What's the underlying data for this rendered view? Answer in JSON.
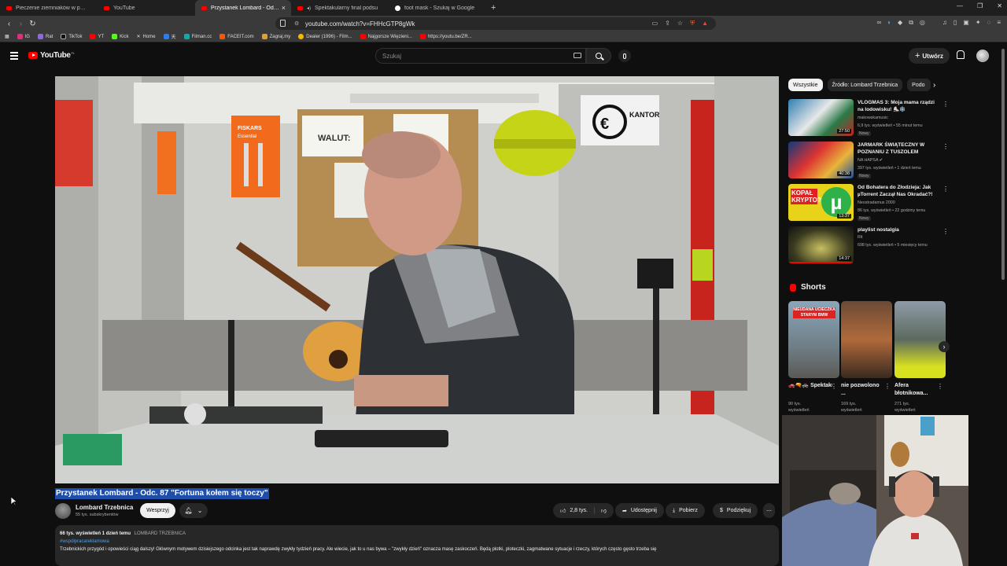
{
  "browser": {
    "tabs": [
      {
        "title": "Pieczenie ziemniaków w przewrócon",
        "icon": "youtube-icon"
      },
      {
        "title": "YouTube",
        "icon": "youtube-icon"
      },
      {
        "title": "Przystanek Lombard - Odc. 8",
        "icon": "youtube-icon",
        "active": true
      },
      {
        "title": "Spektakularny final podsu",
        "icon": "youtube-icon"
      },
      {
        "title": "foot mask - Szukaj w Google",
        "icon": "google-icon"
      }
    ],
    "url": "youtube.com/watch?v=FHHcGTP8gWk",
    "bookmarks": [
      "IG",
      "Rat",
      "TikTok",
      "YT",
      "Kick",
      "Home",
      "",
      "Filman.cc",
      "FACEIT.com",
      "Zagraj.my",
      "Dealer (1996) - Film...",
      "Najgorsze Więzieni...",
      "https://youtu.be/ZR..."
    ]
  },
  "youtube": {
    "logo_text": "YouTube",
    "region": "PL",
    "search_placeholder": "Szukaj",
    "create_label": "Utwórz"
  },
  "video": {
    "title": "Przystanek Lombard - Odc. 87 \"Fortuna kołem się toczy\"",
    "channel": "Lombard Trzebnica",
    "subscribers": "55 tys. subskrybentów",
    "support_label": "Wesprzyj",
    "likes": "2,8 tys.",
    "share_label": "Udostępnij",
    "download_label": "Pobierz",
    "thanks_label": "Podziękuj",
    "views_time": "66 tys. wyświetleń  1 dzień temu",
    "channel_tag": "LOMBARD TRZEBNICA",
    "hashtag": "#współpracareklamowa",
    "description": "Trzebnickich przygód i opowieści ciąg dalszy! Głównym motywem dzisiejszego odcinka jest tak naprawdę zwykły tydzień pracy. Ale wiecie, jak to u nas bywa – \"zwykły dzień\" oznacza masę zaskoczeń. Będą plotki, ploteczki, zagmatwane sytuacje i rzeczy, których często gęsto trzeba się"
  },
  "chips": [
    "Wszystkie",
    "Źródło: Lombard Trzebnica",
    "Podo"
  ],
  "recommendations": [
    {
      "title": "VLOGMAS 3: Moja mama rządzi na lodowisku! ⛸️❄️",
      "channel": "makowskamusic",
      "views": "6,9 tys. wyświetleń • 55 minut temu",
      "badge": "Nowy",
      "duration": "27:50"
    },
    {
      "title": "JARMARK ŚWIĄTECZNY W POZNANIU Z TUSZOLEM",
      "channel": "NA HAPSA ✔",
      "views": "397 tys. wyświetleń • 1 dzień temu",
      "badge": "Nowy",
      "duration": "40:38"
    },
    {
      "title": "Od Bohatera do Złodzieja: Jak µTorrent Zaczął Nas Okradać?!",
      "channel": "Neostradamus 2000",
      "views": "86 tys. wyświetleń • 22 godziny temu",
      "badge": "Nowy",
      "duration": "13:37",
      "thumb_text": "KOPAŁ KRYPTO?"
    },
    {
      "title": "playlist nostalgia",
      "channel": "Rit",
      "views": "698 tys. wyświetleń • 5 miesięcy temu",
      "badge": "",
      "duration": "14:37"
    }
  ],
  "shorts": {
    "heading": "Shorts",
    "items": [
      {
        "title": "🚗🔫🚓 Spektakul...",
        "views": "90 tys. wyświetleń",
        "thumb_text": "NIEUDANA UCIECZKA STARYM BMW"
      },
      {
        "title": "nie pozwolono ...",
        "views": "169 tys. wyświetleń"
      },
      {
        "title": "Afera błotnikowa...",
        "views": "271 tys. wyświetleń"
      }
    ]
  },
  "scene": {
    "sign_walut": "WALUT:",
    "sign_kantor": "KANTOR",
    "sign_bottle": "Essential",
    "sign_fiskars": "FISKARS"
  },
  "colors": {
    "accent": "#ff0000",
    "link": "#3ea6ff",
    "selection": "#1e4eaa"
  }
}
